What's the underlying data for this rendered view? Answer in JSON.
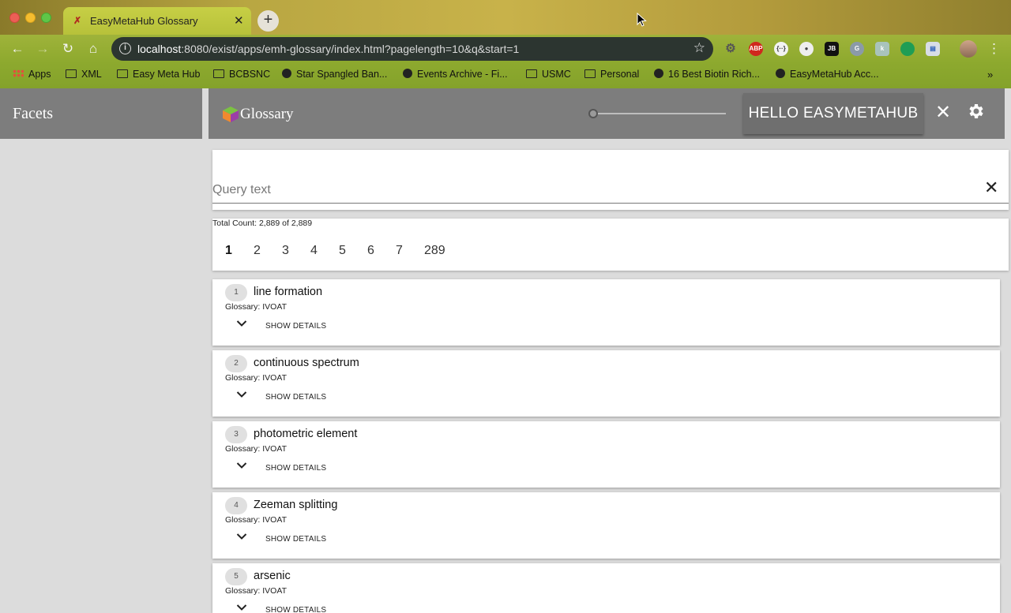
{
  "browser": {
    "tab_title": "EasyMetaHub Glossary",
    "tab_close": "✕",
    "new_tab": "+",
    "url_host": "localhost",
    "url_rest": ":8080/exist/apps/emh-glossary/index.html?pagelength=10&q&start=1",
    "info_icon": "i",
    "star": "☆",
    "extensions": {
      "abp": "ABP",
      "code": "{··}",
      "jb": "JB",
      "g": "G",
      "k": "k",
      "cal": "▤"
    },
    "bookmarks": [
      {
        "label": "Apps",
        "icon": "apps-grid-icon"
      },
      {
        "label": "XML",
        "icon": "folder-icon"
      },
      {
        "label": "Easy Meta Hub",
        "icon": "folder-icon"
      },
      {
        "label": "BCBSNC",
        "icon": "folder-icon"
      },
      {
        "label": "Star Spangled Ban...",
        "icon": "globe-icon"
      },
      {
        "label": "Events Archive - Fi...",
        "icon": "events-icon"
      },
      {
        "label": "USMC",
        "icon": "folder-icon"
      },
      {
        "label": "Personal",
        "icon": "folder-icon"
      },
      {
        "label": "16 Best Biotin Rich...",
        "icon": "globe-icon"
      },
      {
        "label": "EasyMetaHub Acc...",
        "icon": "globe-icon"
      }
    ],
    "more": "»"
  },
  "facets": {
    "title": "Facets"
  },
  "header": {
    "logo_text": "Glossary",
    "slider_value": 0,
    "user_button": "HELLO EASYMETAHUB",
    "close": "✕"
  },
  "search": {
    "placeholder": "Query text",
    "value": "",
    "clear": "✕"
  },
  "results_info": {
    "total_count": "Total Count: 2,889 of 2,889",
    "pages": [
      "1",
      "2",
      "3",
      "4",
      "5",
      "6",
      "7",
      "289"
    ],
    "active_page": "1"
  },
  "results": [
    {
      "index": "1",
      "term": "line formation",
      "glossary": "Glossary: IVOAT",
      "details_label": "SHOW DETAILS"
    },
    {
      "index": "2",
      "term": "continuous spectrum",
      "glossary": "Glossary: IVOAT",
      "details_label": "SHOW DETAILS"
    },
    {
      "index": "3",
      "term": "photometric element",
      "glossary": "Glossary: IVOAT",
      "details_label": "SHOW DETAILS"
    },
    {
      "index": "4",
      "term": "Zeeman splitting",
      "glossary": "Glossary: IVOAT",
      "details_label": "SHOW DETAILS"
    },
    {
      "index": "5",
      "term": "arsenic",
      "glossary": "Glossary: IVOAT",
      "details_label": "SHOW DETAILS"
    }
  ]
}
